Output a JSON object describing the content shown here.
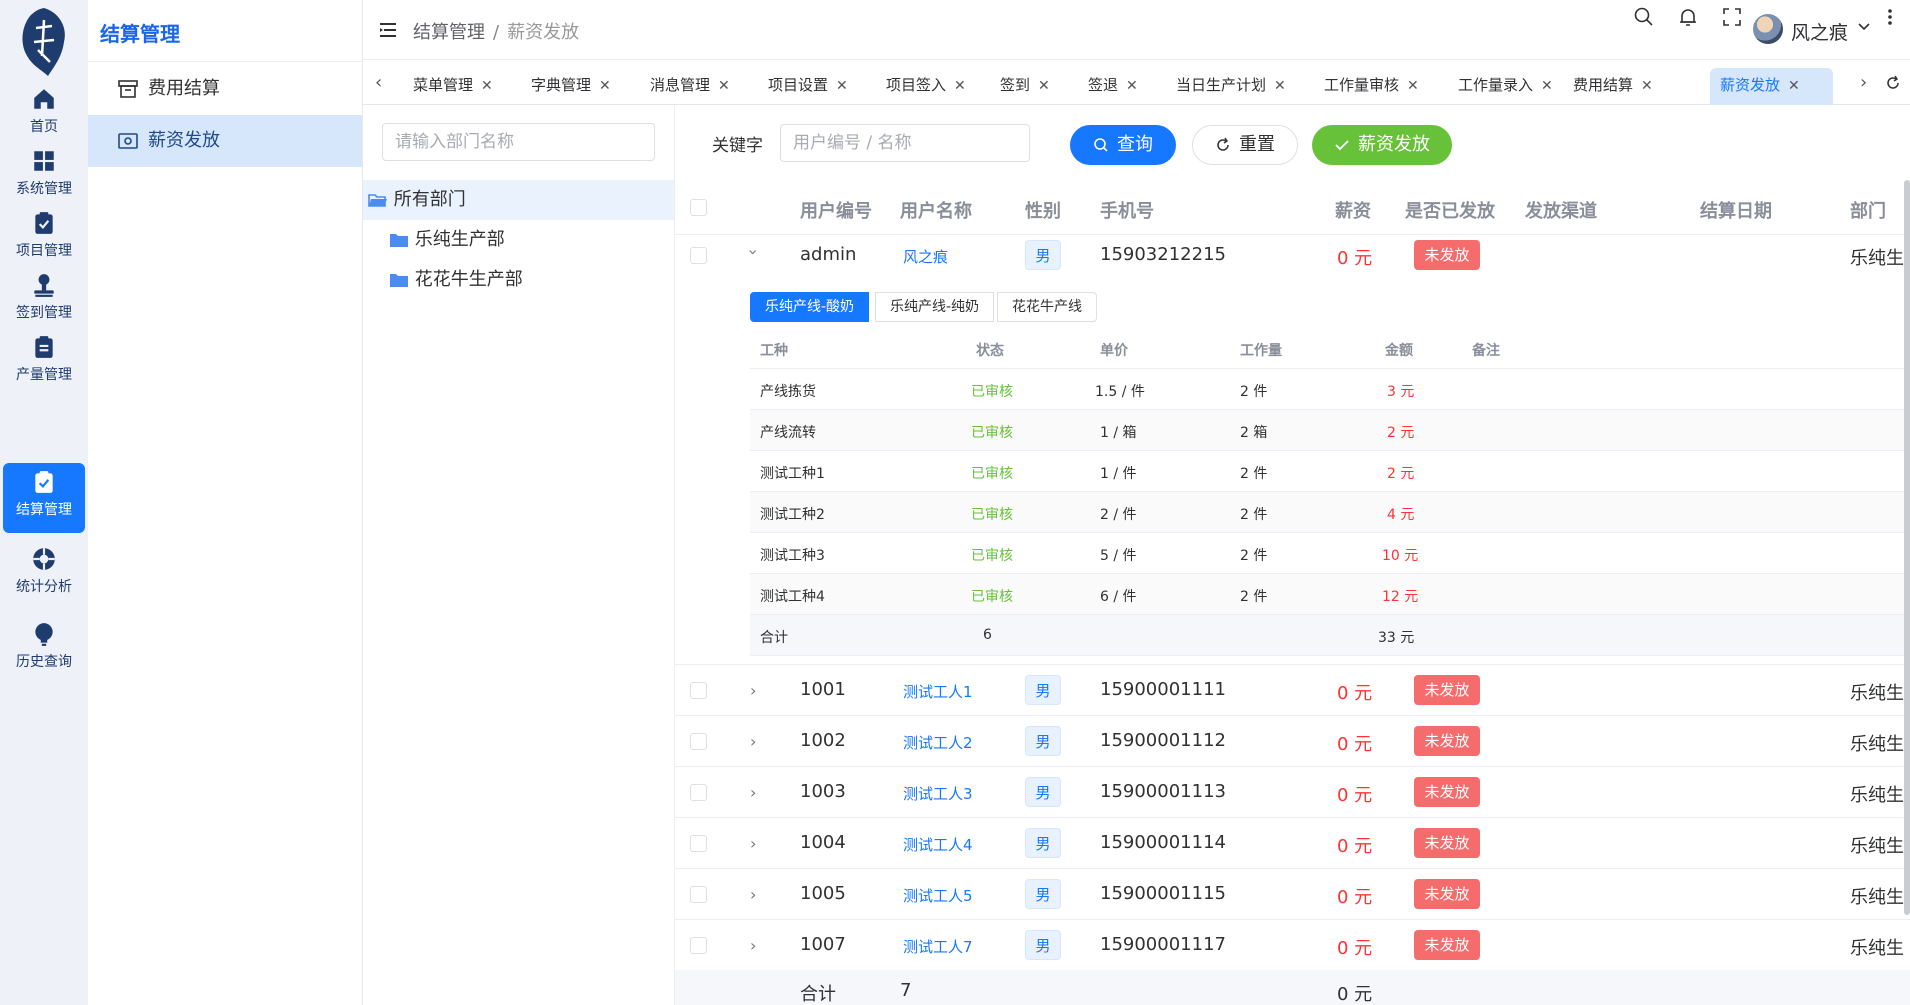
{
  "rail": {
    "items": [
      {
        "label": "首页",
        "icon": "home-icon"
      },
      {
        "label": "系统管理",
        "icon": "grid-icon"
      },
      {
        "label": "项目管理",
        "icon": "clipboard-check-icon"
      },
      {
        "label": "签到管理",
        "icon": "user-stamp-icon"
      },
      {
        "label": "产量管理",
        "icon": "clipboard-list-icon"
      },
      {
        "label": "结算管理",
        "icon": "clipboard-check-icon"
      },
      {
        "label": "统计分析",
        "icon": "lifebuoy-icon"
      },
      {
        "label": "历史查询",
        "icon": "lightbulb-icon"
      }
    ]
  },
  "submenu": {
    "title": "结算管理",
    "items": [
      {
        "label": "费用结算",
        "icon": "archive-icon"
      },
      {
        "label": "薪资发放",
        "icon": "payment-icon"
      }
    ]
  },
  "header": {
    "breadcrumb": [
      "结算管理",
      "薪资发放"
    ],
    "username": "风之痕"
  },
  "tabs": [
    "菜单管理",
    "字典管理",
    "消息管理",
    "项目设置",
    "项目签入",
    "签到",
    "签退",
    "当日生产计划",
    "工作量审核",
    "工作量录入",
    "费用结算",
    "薪资发放"
  ],
  "tree": {
    "search_placeholder": "请输入部门名称",
    "nodes": [
      "所有部门",
      "乐纯生产部",
      "花花牛生产部"
    ]
  },
  "filter": {
    "keyword_label": "关键字",
    "keyword_placeholder": "用户编号 / 名称",
    "query_label": "查询",
    "reset_label": "重置",
    "pay_label": "薪资发放"
  },
  "table": {
    "columns": [
      "用户编号",
      "用户名称",
      "性别",
      "手机号",
      "薪资",
      "是否已发放",
      "发放渠道",
      "结算日期",
      "部门"
    ],
    "rows": [
      {
        "id": "admin",
        "name": "风之痕",
        "gender": "男",
        "phone": "15903212215",
        "salary": "0 元",
        "status": "未发放",
        "dept": "乐纯生"
      },
      {
        "id": "1001",
        "name": "测试工人1",
        "gender": "男",
        "phone": "15900001111",
        "salary": "0 元",
        "status": "未发放",
        "dept": "乐纯生"
      },
      {
        "id": "1002",
        "name": "测试工人2",
        "gender": "男",
        "phone": "15900001112",
        "salary": "0 元",
        "status": "未发放",
        "dept": "乐纯生"
      },
      {
        "id": "1003",
        "name": "测试工人3",
        "gender": "男",
        "phone": "15900001113",
        "salary": "0 元",
        "status": "未发放",
        "dept": "乐纯生"
      },
      {
        "id": "1004",
        "name": "测试工人4",
        "gender": "男",
        "phone": "15900001114",
        "salary": "0 元",
        "status": "未发放",
        "dept": "乐纯生"
      },
      {
        "id": "1005",
        "name": "测试工人5",
        "gender": "男",
        "phone": "15900001115",
        "salary": "0 元",
        "status": "未发放",
        "dept": "乐纯生"
      },
      {
        "id": "1007",
        "name": "测试工人7",
        "gender": "男",
        "phone": "15900001117",
        "salary": "0 元",
        "status": "未发放",
        "dept": "乐纯生"
      }
    ],
    "footer": {
      "label": "合计",
      "count": "7",
      "salary": "0 元"
    }
  },
  "detail": {
    "segments": [
      "乐纯产线-酸奶",
      "乐纯产线-纯奶",
      "花花牛产线"
    ],
    "columns": [
      "工种",
      "状态",
      "单价",
      "工作量",
      "金额",
      "备注"
    ],
    "rows": [
      {
        "type": "产线拣货",
        "status": "已审核",
        "price": "1.5 / 件",
        "qty": "2 件",
        "amount": "3 元"
      },
      {
        "type": "产线流转",
        "status": "已审核",
        "price": "1 / 箱",
        "qty": "2 箱",
        "amount": "2 元"
      },
      {
        "type": "测试工种1",
        "status": "已审核",
        "price": "1 / 件",
        "qty": "2 件",
        "amount": "2 元"
      },
      {
        "type": "测试工种2",
        "status": "已审核",
        "price": "2 / 件",
        "qty": "2 件",
        "amount": "4 元"
      },
      {
        "type": "测试工种3",
        "status": "已审核",
        "price": "5 / 件",
        "qty": "2 件",
        "amount": "10 元"
      },
      {
        "type": "测试工种4",
        "status": "已审核",
        "price": "6 / 件",
        "qty": "2 件",
        "amount": "12 元"
      }
    ],
    "footer": {
      "label": "合计",
      "count": "6",
      "amount": "33 元"
    }
  },
  "colors": {
    "primary": "#1677ff",
    "success": "#67c23a",
    "danger": "#f56c6c",
    "money": "#ff3333"
  }
}
